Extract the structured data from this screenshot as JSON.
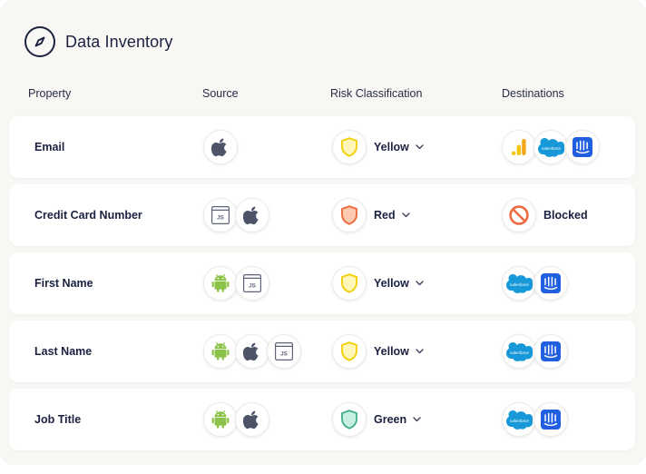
{
  "header": {
    "title": "Data Inventory",
    "icon": "compass-icon"
  },
  "columns": {
    "property": "Property",
    "source": "Source",
    "risk": "Risk Classification",
    "destinations": "Destinations"
  },
  "source_text": {
    "js": "JS",
    "salesforce": "salesforce"
  },
  "colors": {
    "yellow_fill": "#fff6b8",
    "yellow_stroke": "#f2cf0a",
    "red_fill": "#ffcbb0",
    "red_stroke": "#ef6a3a",
    "green_fill": "#c8f0e0",
    "green_stroke": "#46b08b",
    "android": "#8bc34a",
    "apple": "#4d5468",
    "salesforce": "#1798d8",
    "intercom": "#1f5fe0",
    "analytics_orange": "#f4a615",
    "analytics_yellow": "#f8c60f",
    "blocked": "#ee6a3f"
  },
  "rows": [
    {
      "property": "Email",
      "sources": [
        "apple"
      ],
      "risk": "Yellow",
      "risk_level": "yellow",
      "destinations": [
        "google-analytics",
        "salesforce",
        "intercom"
      ],
      "blocked_label": ""
    },
    {
      "property": "Credit Card Number",
      "sources": [
        "javascript",
        "apple"
      ],
      "risk": "Red",
      "risk_level": "red",
      "destinations": [
        "blocked"
      ],
      "blocked_label": "Blocked"
    },
    {
      "property": "First Name",
      "sources": [
        "android",
        "javascript"
      ],
      "risk": "Yellow",
      "risk_level": "yellow",
      "destinations": [
        "salesforce",
        "intercom"
      ],
      "blocked_label": ""
    },
    {
      "property": "Last Name",
      "sources": [
        "android",
        "apple",
        "javascript"
      ],
      "risk": "Yellow",
      "risk_level": "yellow",
      "destinations": [
        "salesforce",
        "intercom"
      ],
      "blocked_label": ""
    },
    {
      "property": "Job Title",
      "sources": [
        "android",
        "apple"
      ],
      "risk": "Green",
      "risk_level": "green",
      "destinations": [
        "salesforce",
        "intercom"
      ],
      "blocked_label": ""
    }
  ]
}
